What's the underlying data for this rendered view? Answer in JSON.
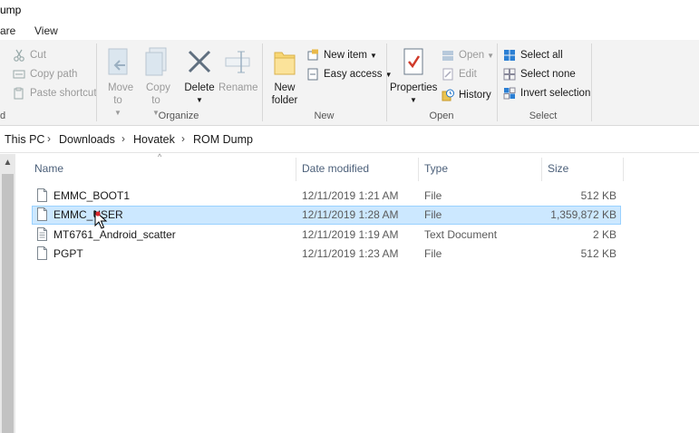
{
  "window": {
    "title": "ump"
  },
  "tabs": [
    {
      "label": "are"
    },
    {
      "label": "View"
    }
  ],
  "ribbon": {
    "clipboard": {
      "cut": "Cut",
      "copy_path": "Copy path",
      "paste_shortcut": "Paste shortcut",
      "group_label_fragment": "d"
    },
    "organize": {
      "move_to": "Move to",
      "copy_to": "Copy to",
      "delete": "Delete",
      "rename": "Rename",
      "label": "Organize"
    },
    "new": {
      "new_folder": "New folder",
      "new_item": "New item",
      "easy_access": "Easy access",
      "label": "New"
    },
    "open": {
      "properties": "Properties",
      "open": "Open",
      "edit": "Edit",
      "history": "History",
      "label": "Open"
    },
    "select": {
      "select_all": "Select all",
      "select_none": "Select none",
      "invert_selection": "Invert selection",
      "label": "Select"
    }
  },
  "breadcrumb": [
    "This PC",
    "Downloads",
    "Hovatek",
    "ROM Dump"
  ],
  "columns": {
    "name": "Name",
    "date": "Date modified",
    "type": "Type",
    "size": "Size"
  },
  "files": [
    {
      "name": "EMMC_BOOT1",
      "date": "12/11/2019 1:21 AM",
      "type": "File",
      "size": "512 KB",
      "selected": false
    },
    {
      "name": "EMMC_USER",
      "date": "12/11/2019 1:28 AM",
      "type": "File",
      "size": "1,359,872 KB",
      "selected": true
    },
    {
      "name": "MT6761_Android_scatter",
      "date": "12/11/2019 1:19 AM",
      "type": "Text Document",
      "size": "2 KB",
      "selected": false
    },
    {
      "name": "PGPT",
      "date": "12/11/2019 1:23 AM",
      "type": "File",
      "size": "512 KB",
      "selected": false
    }
  ],
  "colors": {
    "selection_bg": "#cce8ff",
    "selection_border": "#99d1ff",
    "accent": "#1e73c8",
    "header_text": "#4c607a"
  }
}
